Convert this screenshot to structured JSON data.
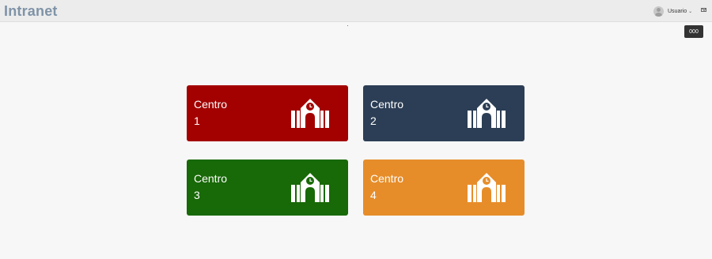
{
  "header": {
    "brand": "Intranet",
    "user_name": "Usuario",
    "caret": "⌄",
    "avatar_icon": "user-avatar-icon",
    "mail_icon": "envelope-icon"
  },
  "tooltip": {
    "text": "000"
  },
  "cards": [
    {
      "title": "Centro",
      "number": "1",
      "color": "#a30000",
      "icon": "school-building-icon"
    },
    {
      "title": "Centro",
      "number": "2",
      "color": "#2c3e55",
      "icon": "school-building-icon"
    },
    {
      "title": "Centro",
      "number": "3",
      "color": "#186907",
      "icon": "school-building-icon"
    },
    {
      "title": "Centro",
      "number": "4",
      "color": "#e68d2a",
      "icon": "school-building-icon"
    }
  ]
}
